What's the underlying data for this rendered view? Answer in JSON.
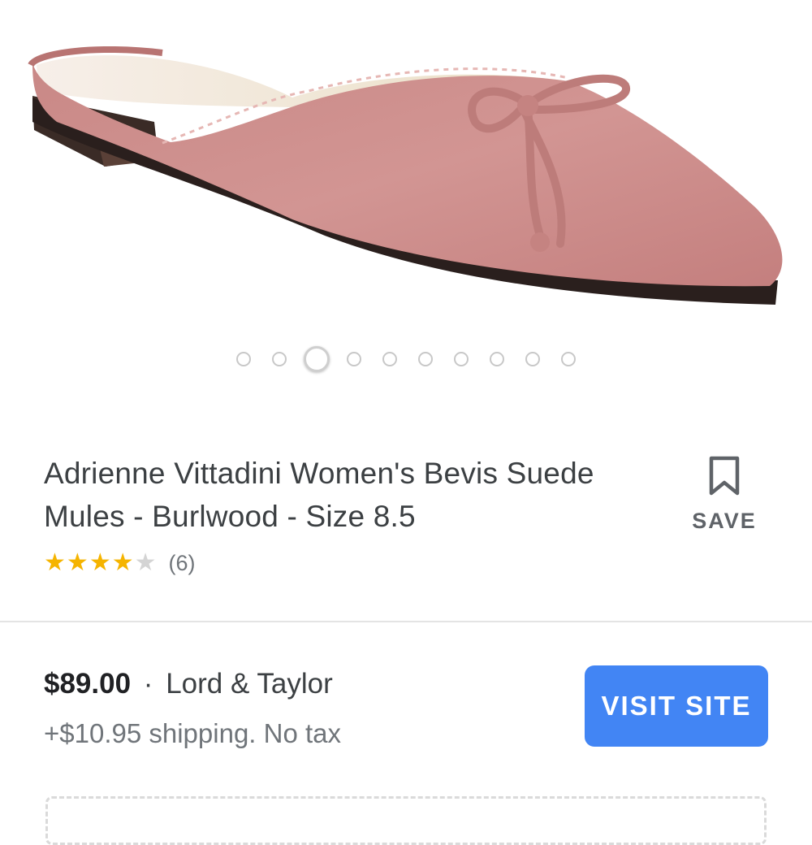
{
  "gallery": {
    "image_alt": "Pink suede mule shoe with bow",
    "dot_count": 10,
    "active_index": 2
  },
  "product": {
    "title_line1": "Adrienne Vittadini Women's Bevis Suede",
    "title_line2": "Mules - Burlwood - Size 8.5",
    "rating": 4,
    "rating_max": 5,
    "review_count": "(6)"
  },
  "save": {
    "label": "SAVE",
    "icon": "bookmark-icon"
  },
  "offer": {
    "price": "$89.00",
    "separator": "·",
    "store": "Lord & Taylor",
    "shipping": "+$10.95 shipping. No tax",
    "button_label": "VISIT SITE"
  },
  "colors": {
    "accent": "#4285f4",
    "star": "#f5b400",
    "shoe": "#cf8e8c"
  }
}
